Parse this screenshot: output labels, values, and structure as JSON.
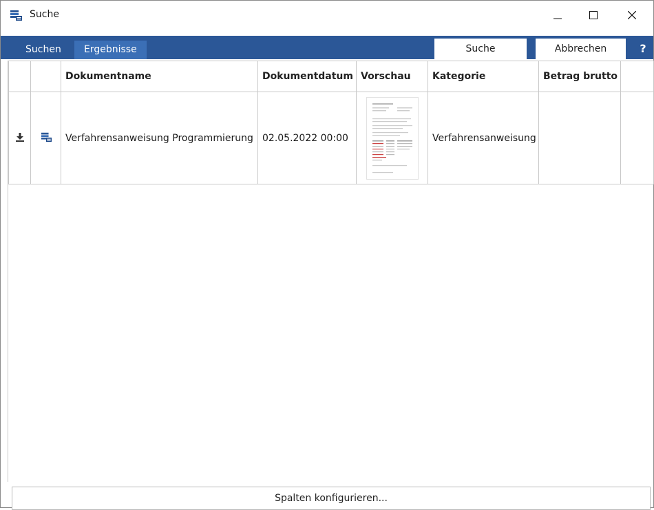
{
  "window": {
    "title": "Suche",
    "app_icon": "stacked-documents-icon",
    "controls": {
      "minimize": "minimize-icon",
      "maximize": "maximize-icon",
      "close": "close-icon"
    }
  },
  "nav": {
    "tabs": [
      {
        "label": "Suchen",
        "active": false
      },
      {
        "label": "Ergebnisse",
        "active": true
      }
    ],
    "search_button": "Suche",
    "cancel_button": "Abbrechen",
    "help_label": "?"
  },
  "colors": {
    "accent": "#2b5797",
    "active_tab": "#3b6fb6"
  },
  "table": {
    "columns": [
      "",
      "",
      "Dokumentname",
      "Dokumentdatum",
      "Vorschau",
      "Kategorie",
      "Betrag brutto",
      ""
    ],
    "rows": [
      {
        "download_icon": "download-icon",
        "doc_icon": "stacked-documents-icon",
        "name": "Verfahrensanweisung Programmierung",
        "date": "02.05.2022 00:00",
        "preview": "document-thumbnail",
        "category": "Verfahrensanweisung",
        "amount": ""
      }
    ]
  },
  "footer": {
    "configure_label": "Spalten konfigurieren..."
  }
}
